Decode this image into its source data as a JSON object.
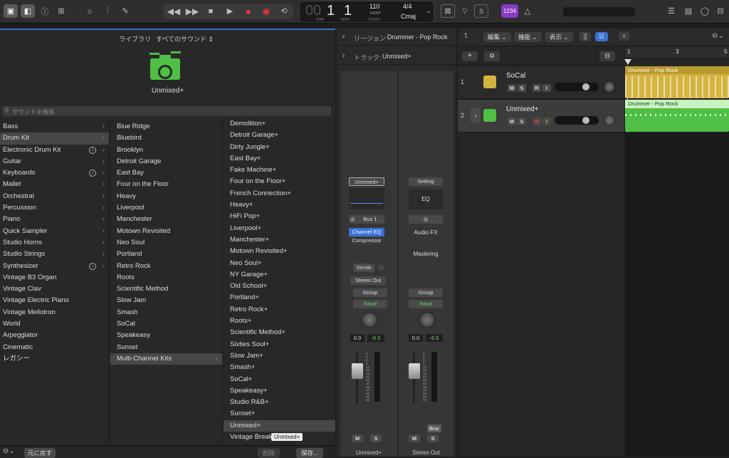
{
  "transport": {
    "bar": "1",
    "bar_prefix": "00",
    "beat": "1",
    "bar_label": "BAR",
    "beat_label": "BEAT",
    "tempo": "110",
    "tempo_mode": "KEEP",
    "tempo_label": "TEMPO",
    "signature": "4/4",
    "key": "Cmaj",
    "count_in": "1234"
  },
  "library": {
    "title": "ライブラリ",
    "filter": "すべてのサウンド",
    "current_patch": "Unmixed+",
    "search_placeholder": "サウンドを検索",
    "categories": [
      "Bass",
      "Drum Kit",
      "Electronic Drum Kit",
      "Guitar",
      "Keyboards",
      "Mallet",
      "Orchestral",
      "Percussion",
      "Piano",
      "Quick Sampler",
      "Studio Horns",
      "Studio Strings",
      "Synthesizer",
      "Vintage B3 Organ",
      "Vintage Clav",
      "Vintage Electric Piano",
      "Vintage Mellotron",
      "World",
      "Arpeggiator",
      "Cinematic",
      "レガシー"
    ],
    "kits": [
      "Blue Ridge",
      "Bluebird",
      "Brooklyn",
      "Detroit Garage",
      "East Bay",
      "Four on the Floor",
      "Heavy",
      "Liverpool",
      "Manchester",
      "Motown Revisited",
      "Neo Soul",
      "Portland",
      "Retro Rock",
      "Roots",
      "Scientific Method",
      "Slow Jam",
      "Smash",
      "SoCal",
      "Speakeasy",
      "Sunset",
      "Multi-Channel Kits"
    ],
    "patches": [
      "Demolition+",
      "Detroit Garage+",
      "Dirty Jungle+",
      "East Bay+",
      "Fake Machine+",
      "Four on the Floor+",
      "French Connection+",
      "Heavy+",
      "HiFi Pop+",
      "Liverpool+",
      "Manchester+",
      "Motown Revisited+",
      "Neo Soul+",
      "NY Garage+",
      "Old School+",
      "Portland+",
      "Retro Rock+",
      "Roots+",
      "Scientific Method+",
      "Sixties Soul+",
      "Slow Jam+",
      "Smash+",
      "SoCal+",
      "Speakeasy+",
      "Studio R&B+",
      "Sunset+",
      "Unmixed+",
      "Vintage Break"
    ],
    "tooltip": "Unmixed+",
    "revert_button": "元に戻す",
    "delete_button": "削除",
    "save_button": "保存..."
  },
  "inspector": {
    "region_label": "リージョン:",
    "region_name": "Drummer - Pop Rock",
    "track_label": "トラック:",
    "track_name": "Unmixed+"
  },
  "strip1": {
    "setting": "Unmixed+",
    "send": "Bus 1",
    "plugin1": "Channel EQ",
    "plugin2": "Compressor",
    "sends": "Sends",
    "output": "Stereo Out",
    "group": "Group",
    "automation": "Read",
    "volume": "0.0",
    "peak": "-6.5",
    "mute": "M",
    "solo": "S",
    "name": "Unmixed+"
  },
  "strip2": {
    "setting": "Setting",
    "eq": "EQ",
    "audiofx": "Audio FX",
    "mastering": "Mastering",
    "group": "Group",
    "automation": "Read",
    "volume": "0.0",
    "peak": "-6.5",
    "mute": "M",
    "solo": "S",
    "bounce": "Bnc",
    "name": "Stereo Out"
  },
  "fader_scale": [
    "0",
    "3",
    "6",
    "9",
    "12",
    "15",
    "18",
    "21",
    "24",
    "30",
    "35",
    "40",
    "45",
    "50",
    "60"
  ],
  "tracks_toolbar": {
    "edit": "編集",
    "functions": "機能",
    "view": "表示"
  },
  "ruler": [
    "1",
    "3",
    "5"
  ],
  "tracks": [
    {
      "number": "1",
      "name": "SoCal",
      "m": "M",
      "s": "S",
      "r": "R",
      "i": "I",
      "region": "Drummer - Pop Rock"
    },
    {
      "number": "2",
      "name": "Unmixed+",
      "m": "M",
      "s": "S",
      "r": "R",
      "i": "I",
      "region": "Drummer - Pop Rock"
    }
  ],
  "colors": {
    "accent": "#3d6fbf",
    "drummer_yellow": "#d4b441",
    "drummer_green": "#4fbf45",
    "record": "#e5383b"
  }
}
